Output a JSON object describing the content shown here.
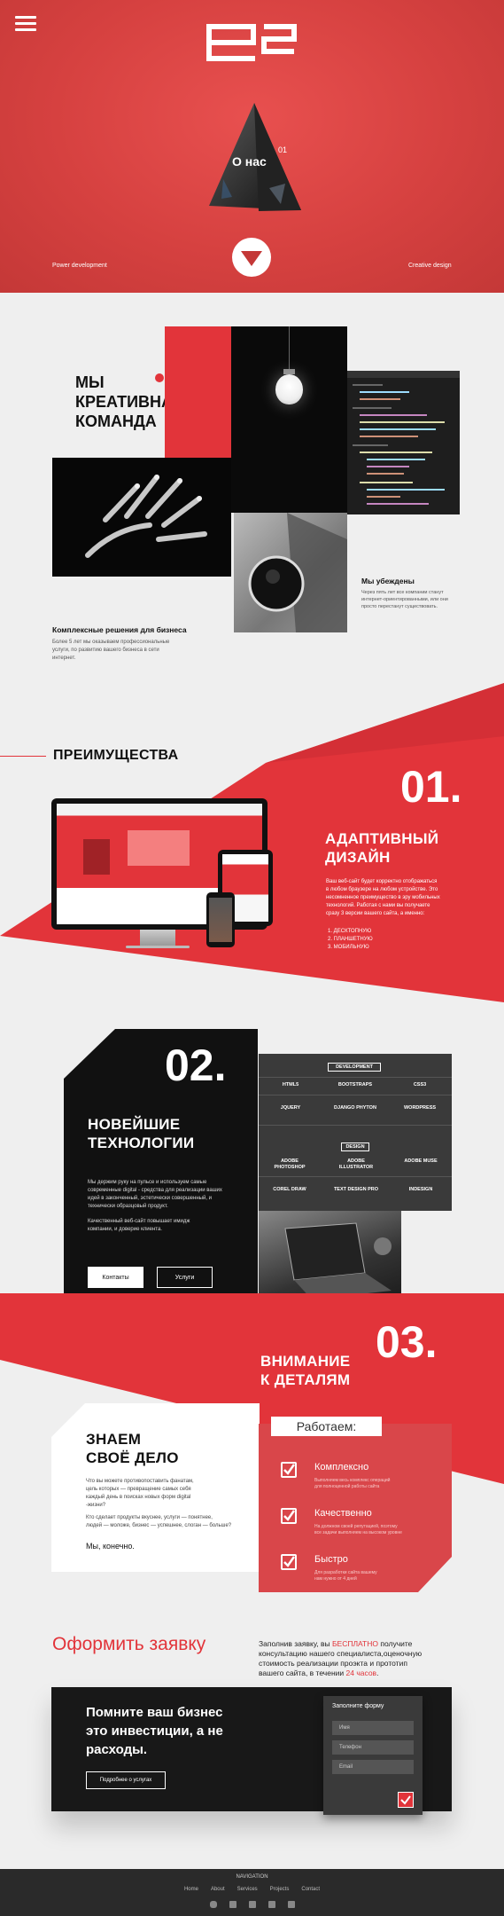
{
  "hero": {
    "about_label": "О нас",
    "about_num": "01",
    "left_caption": "Power development",
    "right_caption": "Creative design"
  },
  "team": {
    "title_line1": "МЫ",
    "title_line2": "КРЕАТИВНАЯ",
    "title_line3": "КОМАНДА",
    "complex_title": "Комплексные решения для бизнеса",
    "complex_text_1": "Более 5 лет мы оказываем профессиональные",
    "complex_text_2": "услуги, по развитию вашего бизнеса в сети",
    "complex_text_3": "интернет.",
    "convinced_title": "Мы убеждены",
    "convinced_text_1": "Через пять лет все компании станут",
    "convinced_text_2": "интернет-ориентированными, или они",
    "convinced_text_3": "просто перестанут существовать."
  },
  "advantages": {
    "title": "ПРЕИМУЩЕСТВА",
    "num": "01.",
    "adaptive_line1": "АДАПТИВНЫЙ",
    "adaptive_line2": "ДИЗАЙН",
    "adaptive_text_1": "Ваш веб-сайт будет корректно отображаться",
    "adaptive_text_2": "в любом браузере на любом устройстве. Это",
    "adaptive_text_3": "несомненное преимущество в эру мобильных",
    "adaptive_text_4": "технологий. Работая с нами вы получаете",
    "adaptive_text_5": "сразу 3 версии вашего сайта, а именно:",
    "list": [
      "1. ДЕСКТОПНУЮ",
      "2. ПЛАНШЕТНУЮ",
      "3. МОБИЛЬНУЮ"
    ]
  },
  "tech": {
    "num": "02.",
    "title_line1": "НОВЕЙШИЕ",
    "title_line2": "ТЕХНОЛОГИИ",
    "text_1": "Мы держим руку на пульсе и используем самые",
    "text_2": "современные digital - средства для реализации ваших",
    "text_3": "идей в законченный, эстетически совершенный, и",
    "text_4": "технически образцовый продукт.",
    "text_5": "Качественный веб-сайт повышает имидж",
    "text_6": "компании, и доверие клиента.",
    "btn_contacts": "Контакты",
    "btn_services": "Услуги",
    "dev_header": "DEVELOPMENT",
    "dev_items": [
      "HTML5",
      "BOOTSTRAPS",
      "CSS3",
      "JQUERY",
      "DJANGO PHYTON",
      "WORDPRESS"
    ],
    "design_header": "DESIGN",
    "design_items_row1": [
      "ADOBE PHOTOSHOP",
      "ADOBE ILLUSTRATOR",
      "ADOBE MUSE"
    ],
    "design_items_row2": [
      "COREL DRAW",
      "TEXT DESIGN PRO",
      "INDESIGN"
    ]
  },
  "attention": {
    "num": "03.",
    "title_line1": "ВНИМАНИЕ",
    "title_line2": "К ДЕТАЛЯМ",
    "know_line1": "ЗНАЕМ",
    "know_line2": "СВОЁ ДЕЛО",
    "know_text_1": "Что вы можете противопоставить фанатам,",
    "know_text_2": "цель которых — превращение самых себя",
    "know_text_3": "каждый день в поисках новых форм digital",
    "know_text_4": "-жизни?",
    "know_text_5": "Кто сделает продукты вкуснее, услуги — понятнее,",
    "know_text_6": "людей — моложе, бизнес — успешнее, слоган — больше?",
    "know_answer": "Мы, конечно.",
    "working_label": "Работаем:",
    "features": [
      {
        "title": "Комплексно",
        "text_1": "Выполняем весь комплекс операций",
        "text_2": "для полноценной работы сайта"
      },
      {
        "title": "Качественно",
        "text_1": "На должном своей репутацией, поэтому",
        "text_2": "все задачи выполняем на высоком уровне"
      },
      {
        "title": "Быстро",
        "text_1": "Для разработки сайта вашему",
        "text_2": "нам нужно от 4 дней"
      }
    ]
  },
  "order": {
    "title": "Оформить заявку",
    "text_pre": "Заполнив заявку, вы ",
    "text_highlight": "БЕСПЛАТНО",
    "text_post": " получите",
    "text_line2": "консультацию нашего специалиста,оценочную",
    "text_line3": "стоимость реализации проэкта и прототип",
    "text_line4_pre": "вашего сайта, в течении ",
    "text_line4_highlight": "24 часов",
    "text_line4_post": ".",
    "banner_line1": "Помните ваш бизнес",
    "banner_line2": "это инвестиции, а не",
    "banner_line3": "расходы.",
    "banner_btn": "Подробнее о услугах",
    "form_title": "Заполните форму",
    "name_placeholder": "Имя",
    "phone_placeholder": "Телефон",
    "email_placeholder": "Email"
  },
  "footer": {
    "nav_title": "NAVIGATION",
    "links": [
      "Home",
      "About",
      "Services",
      "Projects",
      "Contact"
    ]
  },
  "colors": {
    "accent": "#e2343a",
    "dark": "#111111",
    "footer": "#2a2a2a"
  }
}
